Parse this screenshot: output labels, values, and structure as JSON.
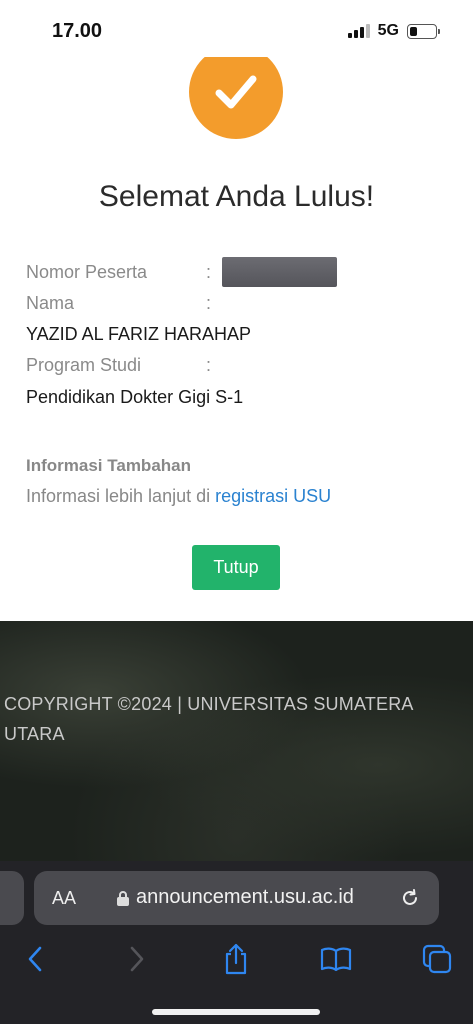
{
  "status": {
    "time": "17.00",
    "network": "5G"
  },
  "result": {
    "title": "Selemat Anda Lulus!",
    "fields": {
      "nomor_label": "Nomor Peserta",
      "nama_label": "Nama",
      "name_value": "YAZID AL FARIZ HARAHAP",
      "program_label": "Program Studi",
      "program_value": "Pendidikan Dokter Gigi S-1",
      "colon": ":"
    },
    "extra_title": "Informasi Tambahan",
    "extra_text": "Informasi lebih lanjut di ",
    "extra_link": "registrasi USU",
    "close_label": "Tutup"
  },
  "footer": {
    "copyright": "COPYRIGHT ©2024 | UNIVERSITAS SUMATERA UTARA"
  },
  "browser": {
    "text_size_label": "AA",
    "url": "announcement.usu.ac.id",
    "icons": [
      "back-icon",
      "forward-icon",
      "share-icon",
      "bookmarks-icon",
      "tabs-icon"
    ]
  },
  "colors": {
    "accent_orange": "#f39c2c",
    "button_green": "#22b36b",
    "link_blue": "#2a82d0"
  }
}
